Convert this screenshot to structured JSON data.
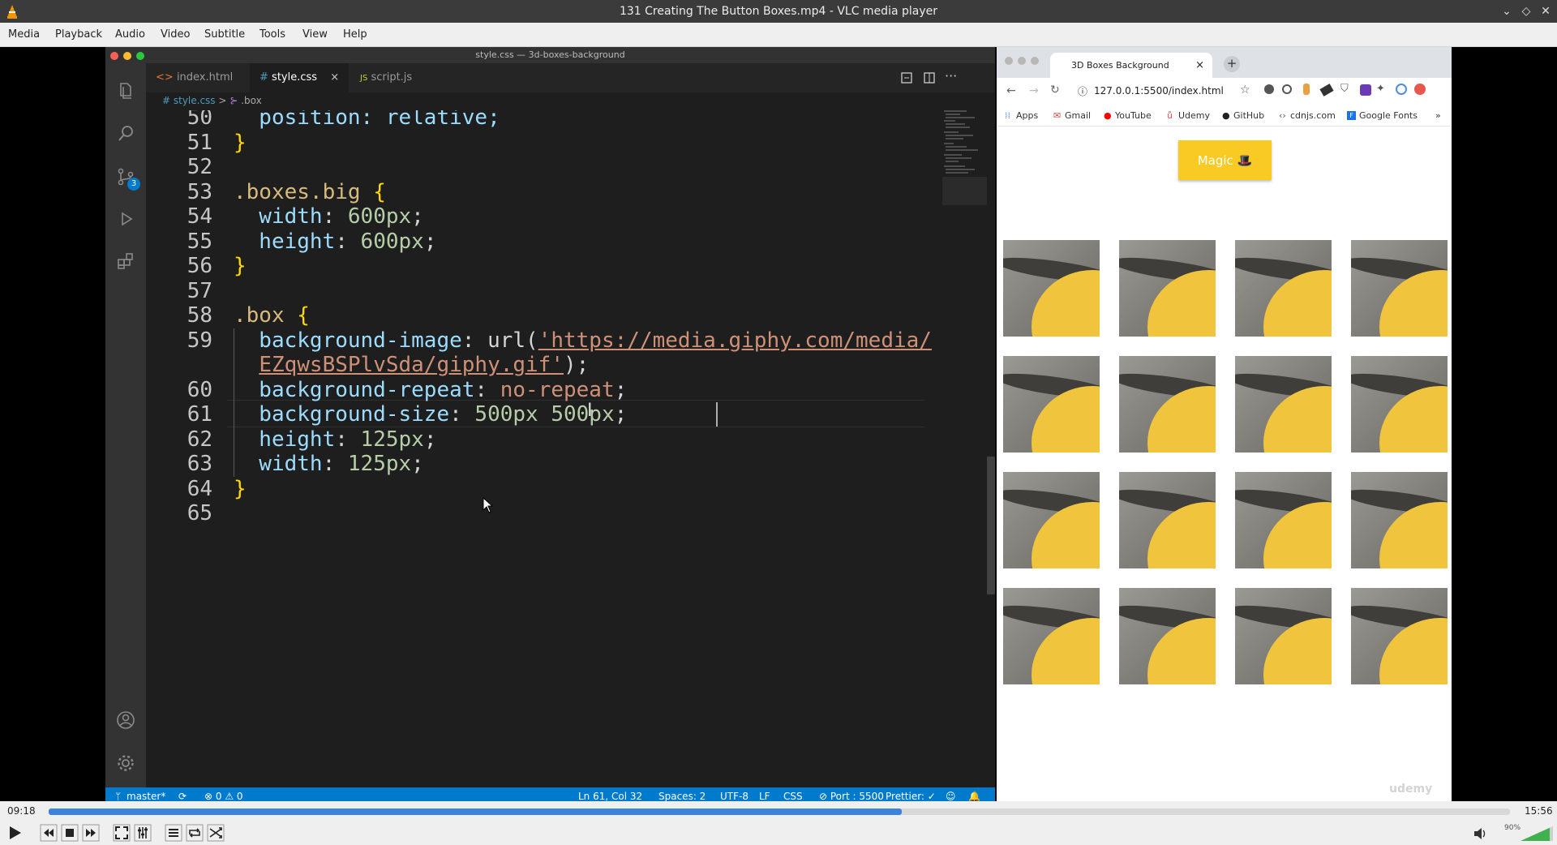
{
  "window": {
    "title": "131 Creating The Button Boxes.mp4 - VLC media player"
  },
  "menubar": [
    "Media",
    "Playback",
    "Audio",
    "Video",
    "Subtitle",
    "Tools",
    "View",
    "Help"
  ],
  "vscode": {
    "window_title": "style.css — 3d-boxes-background",
    "tabs": [
      {
        "icon": "<>",
        "label": "index.html",
        "active": false
      },
      {
        "icon": "#",
        "label": "style.css",
        "active": true,
        "close": "×"
      },
      {
        "icon": "JS",
        "label": "script.js",
        "active": false
      }
    ],
    "breadcrumb": {
      "file": "# style.css",
      "sep": ">",
      "symbol": ".box"
    },
    "source_control_badge": "3",
    "code_lines": [
      {
        "ln": "50",
        "parts": [
          {
            "t": "  position: relative;",
            "c": "prop"
          }
        ]
      },
      {
        "ln": "51",
        "parts": [
          {
            "t": "}",
            "c": "brace"
          }
        ]
      },
      {
        "ln": "52",
        "parts": []
      },
      {
        "ln": "53",
        "parts": [
          {
            "t": ".boxes.big ",
            "c": "sel"
          },
          {
            "t": "{",
            "c": "brace"
          }
        ]
      },
      {
        "ln": "54",
        "parts": [
          {
            "t": "  width",
            "c": "prop"
          },
          {
            "t": ": ",
            "c": "punc"
          },
          {
            "t": "600px",
            "c": "num"
          },
          {
            "t": ";",
            "c": "punc"
          }
        ]
      },
      {
        "ln": "55",
        "parts": [
          {
            "t": "  height",
            "c": "prop"
          },
          {
            "t": ": ",
            "c": "punc"
          },
          {
            "t": "600px",
            "c": "num"
          },
          {
            "t": ";",
            "c": "punc"
          }
        ]
      },
      {
        "ln": "56",
        "parts": [
          {
            "t": "}",
            "c": "brace"
          }
        ]
      },
      {
        "ln": "57",
        "parts": []
      },
      {
        "ln": "58",
        "parts": [
          {
            "t": ".box ",
            "c": "sel"
          },
          {
            "t": "{",
            "c": "brace"
          }
        ]
      },
      {
        "ln": "59",
        "parts": [
          {
            "t": "  background-image",
            "c": "prop"
          },
          {
            "t": ": url(",
            "c": "punc"
          },
          {
            "t": "'https://media.giphy.com/media/",
            "c": "str"
          }
        ]
      },
      {
        "ln": "",
        "parts": [
          {
            "t": "  ",
            "c": "punc"
          },
          {
            "t": "EZqwsBSPlvSda/giphy.gif'",
            "c": "str"
          },
          {
            "t": ");",
            "c": "punc"
          }
        ]
      },
      {
        "ln": "60",
        "parts": [
          {
            "t": "  background-repeat",
            "c": "prop"
          },
          {
            "t": ": ",
            "c": "punc"
          },
          {
            "t": "no-repeat",
            "c": "str-plain"
          },
          {
            "t": ";",
            "c": "punc"
          }
        ]
      },
      {
        "ln": "61",
        "parts": [
          {
            "t": "  background-size",
            "c": "prop"
          },
          {
            "t": ": ",
            "c": "punc"
          },
          {
            "t": "500px 500px",
            "c": "num"
          },
          {
            "t": ";",
            "c": "punc"
          }
        ]
      },
      {
        "ln": "62",
        "parts": [
          {
            "t": "  height",
            "c": "prop"
          },
          {
            "t": ": ",
            "c": "punc"
          },
          {
            "t": "125px",
            "c": "num"
          },
          {
            "t": ";",
            "c": "punc"
          }
        ]
      },
      {
        "ln": "63",
        "parts": [
          {
            "t": "  width",
            "c": "prop"
          },
          {
            "t": ": ",
            "c": "punc"
          },
          {
            "t": "125px",
            "c": "num"
          },
          {
            "t": ";",
            "c": "punc"
          }
        ]
      },
      {
        "ln": "64",
        "parts": [
          {
            "t": "}",
            "c": "brace"
          }
        ]
      },
      {
        "ln": "65",
        "parts": []
      }
    ],
    "statusbar": {
      "branch": "master*",
      "problems": "⊗ 0 ⚠ 0",
      "position": "Ln 61, Col 32",
      "spaces": "Spaces: 2",
      "encoding": "UTF-8",
      "eol": "LF",
      "language": "CSS",
      "port": "⊘ Port : 5500",
      "prettier": "Prettier: ✓"
    }
  },
  "browser": {
    "tab_title": "3D Boxes Background",
    "tab_close": "×",
    "new_tab": "+",
    "url": "127.0.0.1:5500/index.html",
    "bookmarks": [
      "Apps",
      "Gmail",
      "YouTube",
      "Udemy",
      "GitHub",
      "cdnjs.com",
      "Google Fonts"
    ],
    "bookmarks_more": "»",
    "magic_button": "Magic 🎩",
    "watermark": "udemy",
    "grid": {
      "rows": 4,
      "cols": 4
    }
  },
  "player": {
    "elapsed": "09:18",
    "total": "15:56",
    "progress": 0.584,
    "volume_label": "90%",
    "volume": 0.9
  },
  "colors": {
    "vscode_status": "#007acc",
    "magic_button": "#f9ca24",
    "seek_fill": "#3b84d9"
  }
}
